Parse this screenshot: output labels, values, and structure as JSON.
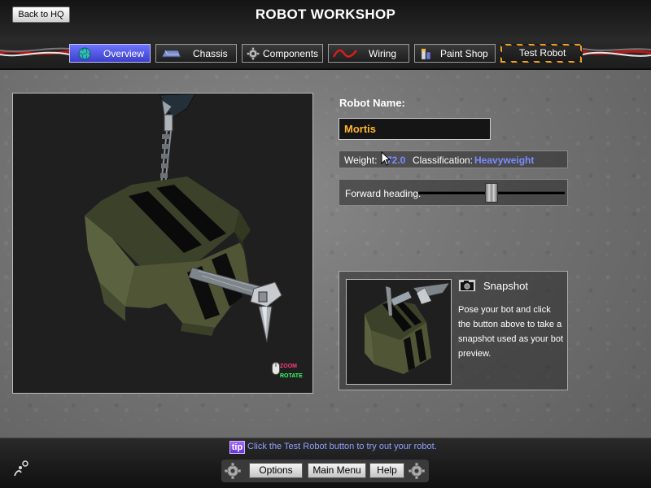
{
  "header": {
    "back_label": "Back to HQ",
    "title": "ROBOT WORKSHOP"
  },
  "tabs": [
    {
      "label": "Overview",
      "icon": "globe-icon",
      "active": true
    },
    {
      "label": "Chassis",
      "icon": "chassis-icon",
      "active": false
    },
    {
      "label": "Components",
      "icon": "gear-icon",
      "active": false
    },
    {
      "label": "Wiring",
      "icon": "wire-icon",
      "active": false
    },
    {
      "label": "Paint Shop",
      "icon": "paint-cans-icon",
      "active": false
    },
    {
      "label": "Test Robot",
      "icon": "",
      "active": false
    }
  ],
  "viewport": {
    "zoom_hint": "ZOOM",
    "rotate_hint": "ROTATE"
  },
  "robot": {
    "name_label": "Robot Name:",
    "name_value": "Mortis",
    "weight_label": "Weight:",
    "weight_value": "72.0",
    "classification_label": "Classification:",
    "classification_value": "Heavyweight",
    "heading_label": "Forward heading:",
    "heading_level": 0.5
  },
  "snapshot": {
    "title": "Snapshot",
    "description": "Pose your bot and click the button above to take a snapshot used as your bot preview."
  },
  "footer": {
    "tip_badge": "tip",
    "tip_text": "Click the Test Robot button to try out your robot.",
    "buttons": [
      "Options",
      "Main Menu",
      "Help"
    ]
  },
  "colors": {
    "accent_name": "#ffb52e",
    "accent_blue": "#7b8cff",
    "active_tab": "#5a5fe8"
  }
}
